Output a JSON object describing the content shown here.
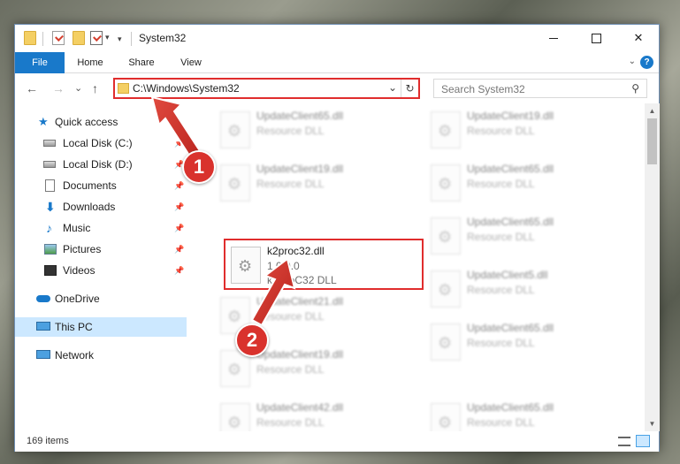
{
  "window": {
    "title": "System32",
    "quick_access_dropdown": "▾"
  },
  "ribbon": {
    "tabs": [
      {
        "label": "File"
      },
      {
        "label": "Home"
      },
      {
        "label": "Share"
      },
      {
        "label": "View"
      }
    ],
    "expand": "⌄",
    "help": "?"
  },
  "nav": {
    "back": "←",
    "forward": "→",
    "recent": "⌄",
    "up": "↑",
    "address": "C:\\Windows\\System32",
    "address_dropdown": "⌄",
    "refresh": "↻",
    "search_placeholder": "Search System32",
    "search_icon": "⚲"
  },
  "sidebar": {
    "items": [
      {
        "label": "Quick access",
        "icon": "star-icon"
      },
      {
        "label": "Local Disk (C:)",
        "icon": "disk-icon",
        "pin": "📌"
      },
      {
        "label": "Local Disk (D:)",
        "icon": "disk-icon",
        "pin": "📌"
      },
      {
        "label": "Documents",
        "icon": "document-icon",
        "pin": "📌"
      },
      {
        "label": "Downloads",
        "icon": "download-icon",
        "pin": "📌"
      },
      {
        "label": "Music",
        "icon": "music-icon",
        "pin": "📌"
      },
      {
        "label": "Pictures",
        "icon": "pictures-icon",
        "pin": "📌"
      },
      {
        "label": "Videos",
        "icon": "video-icon",
        "pin": "📌"
      },
      {
        "label": "OneDrive",
        "icon": "cloud-icon"
      },
      {
        "label": "This PC",
        "icon": "computer-icon"
      },
      {
        "label": "Network",
        "icon": "network-icon"
      }
    ]
  },
  "files": {
    "left": [
      {
        "name": "UpdateClient65.dll",
        "type": "Resource DLL"
      },
      {
        "name": "UpdateClient19.dll",
        "type": "Resource DLL"
      },
      {
        "name": "k2proc32.dll",
        "version": "1.0.0.0",
        "type": "k2ProC32 DLL"
      },
      {
        "name": "UpdateClient21.dll",
        "type": "Resource DLL"
      },
      {
        "name": "UpdateClient19.dll",
        "type": "Resource DLL"
      },
      {
        "name": "UpdateClient42.dll",
        "type": "Resource DLL"
      }
    ],
    "right": [
      {
        "name": "UpdateClient19.dll",
        "type": "Resource DLL"
      },
      {
        "name": "UpdateClient65.dll",
        "type": "Resource DLL"
      },
      {
        "name": "UpdateClient65.dll",
        "type": "Resource DLL"
      },
      {
        "name": "UpdateClient5.dll",
        "type": "Resource DLL"
      },
      {
        "name": "UpdateClient65.dll",
        "type": "Resource DLL"
      },
      {
        "name": "UpdateClient65.dll",
        "type": "Resource DLL"
      }
    ]
  },
  "status": {
    "count": "169 items"
  },
  "annotations": {
    "step1": "1",
    "step2": "2"
  },
  "colors": {
    "accent": "#1979ca",
    "highlight_red": "#e02d2d",
    "badge_red": "#d9322d",
    "selected": "#cce8ff"
  }
}
